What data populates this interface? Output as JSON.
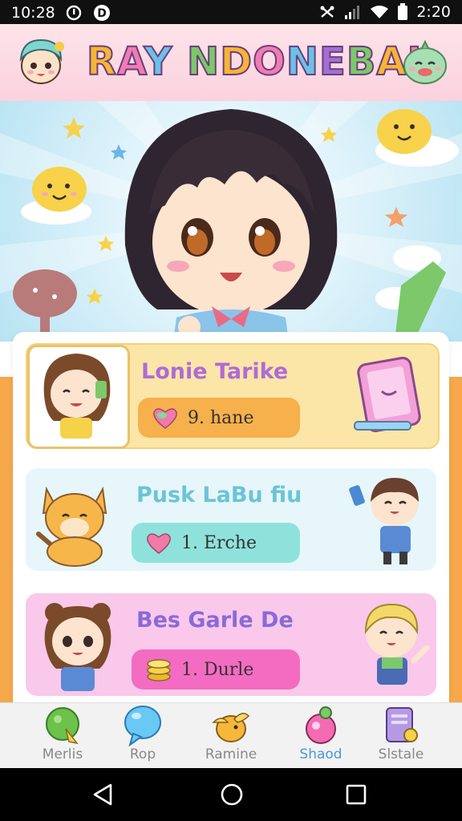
{
  "status_bar": {
    "time_left": "10:28",
    "time_right": "2:20"
  },
  "header": {
    "title": "RAY NDONEBAI",
    "title_colors": [
      "#f7b536",
      "#f27bb3",
      "#6bc1e8",
      "#a36fd6",
      "#7cc86a"
    ]
  },
  "list": {
    "rows": [
      {
        "title": "Lonie Tarike",
        "pill_text": "9. hane",
        "pill_icon": "heart-icon",
        "bg": "#fbe6a8",
        "title_color": "#b06ad6",
        "pill_color": "#f6b04c"
      },
      {
        "title": "Pusk LaBu fiu",
        "pill_text": "1. Erche",
        "pill_icon": "heart-icon",
        "bg": "#e7f6fa",
        "title_color": "#6bc4d8",
        "pill_color": "#8fe2dc"
      },
      {
        "title": "Bes Garle De",
        "pill_text": "1. Durle",
        "pill_icon": "coin-stack-icon",
        "bg": "#f9c8ea",
        "title_color": "#8a6ad8",
        "pill_color": "#f36cc2"
      }
    ]
  },
  "bottom_nav": {
    "items": [
      {
        "label": "Merlis",
        "icon": "green-leaf-icon",
        "active": false
      },
      {
        "label": "Rop",
        "icon": "chat-bubble-icon",
        "active": false
      },
      {
        "label": "Ramine",
        "icon": "bird-icon",
        "active": false
      },
      {
        "label": "Shaod",
        "icon": "bomb-icon",
        "active": true
      },
      {
        "label": "Slstale",
        "icon": "notepad-icon",
        "active": false
      }
    ]
  },
  "system_nav": {
    "back": "back-triangle-icon",
    "home": "home-circle-icon",
    "recents": "recents-square-icon"
  }
}
